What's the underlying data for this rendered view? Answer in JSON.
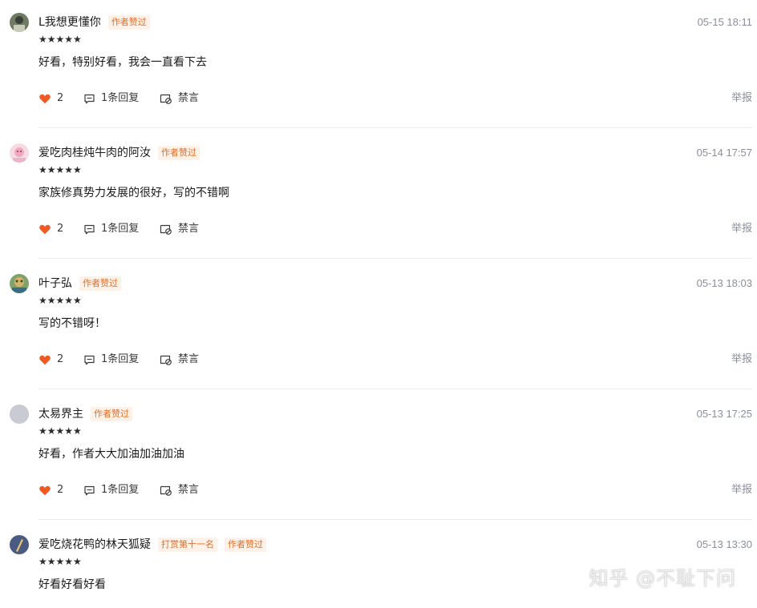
{
  "comments": [
    {
      "user": "L我想更懂你",
      "badges": [
        "作者赞过"
      ],
      "time": "05-15 18:11",
      "stars": "★★★★★",
      "text": "好看，特别好看，我会一直看下去",
      "likes": "2",
      "reply_label": "1条回复",
      "ban_label": "禁言",
      "report_label": "举报"
    },
    {
      "user": "爱吃肉桂炖牛肉的阿汝",
      "badges": [
        "作者赞过"
      ],
      "time": "05-14 17:57",
      "stars": "★★★★★",
      "text": "家族修真势力发展的很好，写的不错啊",
      "likes": "2",
      "reply_label": "1条回复",
      "ban_label": "禁言",
      "report_label": "举报"
    },
    {
      "user": "叶子弘",
      "badges": [
        "作者赞过"
      ],
      "time": "05-13 18:03",
      "stars": "★★★★★",
      "text": "写的不错呀！",
      "likes": "2",
      "reply_label": "1条回复",
      "ban_label": "禁言",
      "report_label": "举报"
    },
    {
      "user": "太易界主",
      "badges": [
        "作者赞过"
      ],
      "time": "05-13 17:25",
      "stars": "★★★★★",
      "text": "好看，作者大大加油加油加油",
      "likes": "2",
      "reply_label": "1条回复",
      "ban_label": "禁言",
      "report_label": "举报"
    },
    {
      "user": "爱吃烧花鸭的林天狐疑",
      "badges": [
        "打赏第十一名",
        "作者赞过"
      ],
      "time": "05-13 13:30",
      "stars": "★★★★★",
      "text": "好看好看好看"
    }
  ],
  "watermark": "知乎 @不耻下问",
  "colors": {
    "badge_text": "#e0702a",
    "badge_bg": "#fdf1e8",
    "like_heart": "#ee5a24",
    "muted": "#8a8f99"
  }
}
